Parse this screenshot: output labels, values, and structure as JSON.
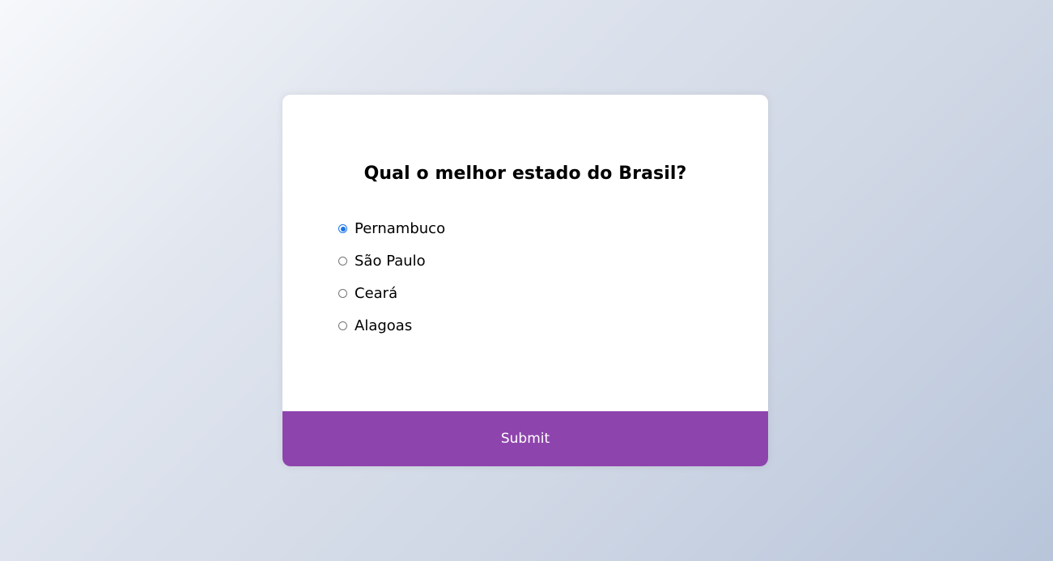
{
  "quiz": {
    "question": "Qual o melhor estado do Brasil?",
    "answers": [
      {
        "label": "Pernambuco",
        "selected": true
      },
      {
        "label": "São Paulo",
        "selected": false
      },
      {
        "label": "Ceará",
        "selected": false
      },
      {
        "label": "Alagoas",
        "selected": false
      }
    ],
    "submit_label": "Submit"
  },
  "colors": {
    "accent": "#8e44ad",
    "radio_selected": "#1a73e8",
    "card_background": "#ffffff"
  }
}
